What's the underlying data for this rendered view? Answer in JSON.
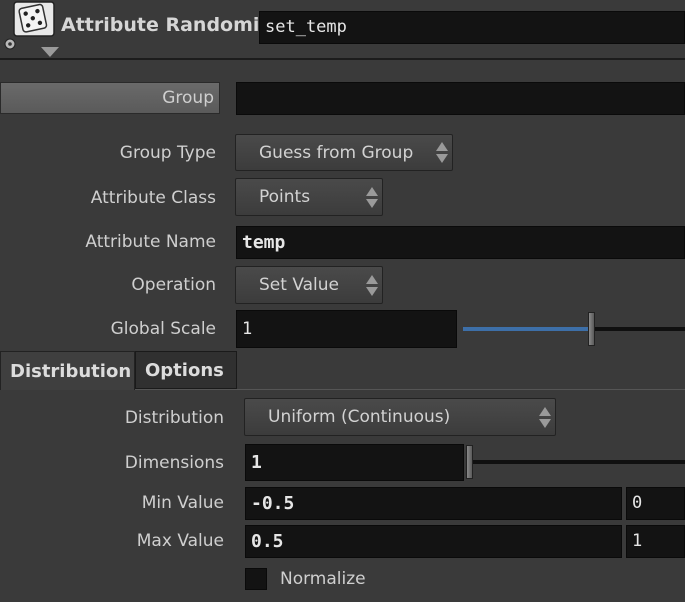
{
  "header": {
    "node_type": "Attribute Randomize",
    "node_name": "set_temp"
  },
  "fields": {
    "group": {
      "label": "Group",
      "value": ""
    },
    "group_type": {
      "label": "Group Type",
      "value": "Guess from Group"
    },
    "attribute_class": {
      "label": "Attribute Class",
      "value": "Points"
    },
    "attribute_name": {
      "label": "Attribute Name",
      "value": "temp"
    },
    "operation": {
      "label": "Operation",
      "value": "Set Value"
    },
    "global_scale": {
      "label": "Global Scale",
      "value": "1",
      "slider_fraction": 0.58
    }
  },
  "tabs": [
    {
      "label": "Distribution",
      "active": true
    },
    {
      "label": "Options",
      "active": false
    }
  ],
  "distribution": {
    "distribution": {
      "label": "Distribution",
      "value": "Uniform (Continuous)"
    },
    "dimensions": {
      "label": "Dimensions",
      "value": "1",
      "slider_fraction": 0.0
    },
    "min_value": {
      "label": "Min Value",
      "value_1": "-0.5",
      "value_2": "0"
    },
    "max_value": {
      "label": "Max Value",
      "value_1": "0.5",
      "value_2": "1"
    },
    "normalize": {
      "label": "Normalize",
      "checked": false
    }
  },
  "colors": {
    "background": "#3a3a3a",
    "field": "#131313",
    "slider_fill": "#3d6fa8",
    "group_bar": "#616161"
  }
}
